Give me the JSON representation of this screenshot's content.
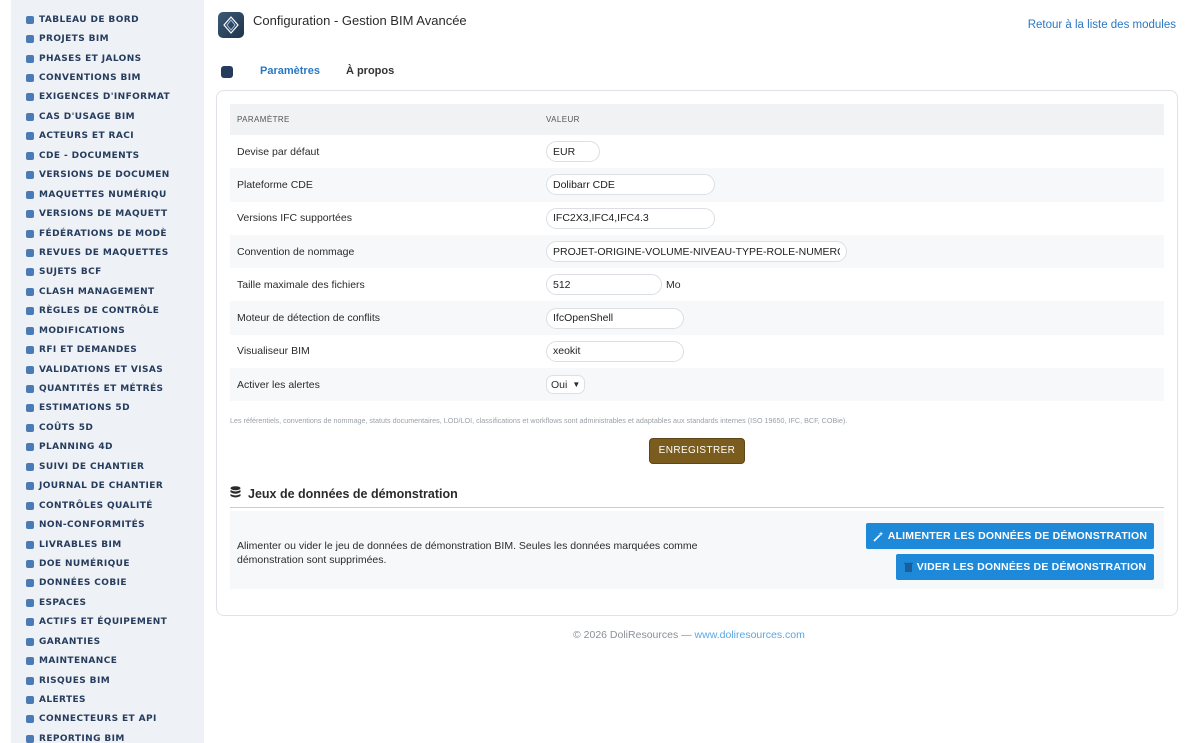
{
  "sidebar": {
    "items": [
      {
        "label": "TABLEAU DE BORD",
        "icon": "dashboard-icon"
      },
      {
        "label": "PROJETS BIM",
        "icon": "project-diagram-icon"
      },
      {
        "label": "PHASES ET JALONS",
        "icon": "layers-icon"
      },
      {
        "label": "CONVENTIONS BIM",
        "icon": "file-signature-icon"
      },
      {
        "label": "EXIGENCES D'INFORMAT",
        "icon": "clipboard-icon"
      },
      {
        "label": "CAS D'USAGE BIM",
        "icon": "clipboard-check-icon"
      },
      {
        "label": "ACTEURS ET RACI",
        "icon": "users-icon"
      },
      {
        "label": "CDE - DOCUMENTS",
        "icon": "folder-icon"
      },
      {
        "label": "VERSIONS DE DOCUMEN",
        "icon": "code-branch-icon"
      },
      {
        "label": "MAQUETTES NUMÉRIQU",
        "icon": "cubes-icon"
      },
      {
        "label": "VERSIONS DE MAQUETT",
        "icon": "code-branch-icon"
      },
      {
        "label": "FÉDÉRATIONS DE MODÈ",
        "icon": "sitemap-icon"
      },
      {
        "label": "REVUES DE MAQUETTES",
        "icon": "search-icon"
      },
      {
        "label": "SUJETS BCF",
        "icon": "comments-icon"
      },
      {
        "label": "CLASH MANAGEMENT",
        "icon": "warning-icon"
      },
      {
        "label": "RÈGLES DE CONTRÔLE",
        "icon": "cogs-icon"
      },
      {
        "label": "MODIFICATIONS",
        "icon": "edit-icon"
      },
      {
        "label": "RFI ET DEMANDES",
        "icon": "question-circle-icon"
      },
      {
        "label": "VALIDATIONS ET VISAS",
        "icon": "check-double-icon"
      },
      {
        "label": "QUANTITÉS ET MÉTRÉS",
        "icon": "calculator-icon"
      },
      {
        "label": "ESTIMATIONS 5D",
        "icon": "file-invoice-icon"
      },
      {
        "label": "COÛTS 5D",
        "icon": "money-bill-icon"
      },
      {
        "label": "PLANNING 4D",
        "icon": "calendar-icon"
      },
      {
        "label": "SUIVI DE CHANTIER",
        "icon": "hard-hat-icon"
      },
      {
        "label": "JOURNAL DE CHANTIER",
        "icon": "clipboard-list-icon"
      },
      {
        "label": "CONTRÔLES QUALITÉ",
        "icon": "check-circle-icon"
      },
      {
        "label": "NON-CONFORMITÉS",
        "icon": "times-circle-icon"
      },
      {
        "label": "LIVRABLES BIM",
        "icon": "briefcase-icon"
      },
      {
        "label": "DOE NUMÉRIQUE",
        "icon": "book-open-icon"
      },
      {
        "label": "DONNÉES COBIE",
        "icon": "table-icon"
      },
      {
        "label": "ESPACES",
        "icon": "door-open-icon"
      },
      {
        "label": "ACTIFS ET ÉQUIPEMENT",
        "icon": "cogs-icon"
      },
      {
        "label": "GARANTIES",
        "icon": "shield-icon"
      },
      {
        "label": "MAINTENANCE",
        "icon": "wrench-icon"
      },
      {
        "label": "RISQUES BIM",
        "icon": "warning-icon"
      },
      {
        "label": "ALERTES",
        "icon": "bell-icon"
      },
      {
        "label": "CONNECTEURS ET API",
        "icon": "plug-icon"
      },
      {
        "label": "REPORTING BIM",
        "icon": "chart-pie-icon"
      }
    ]
  },
  "header": {
    "title": "Configuration - Gestion BIM Avancée",
    "back_link": "Retour à la liste des modules"
  },
  "tabs": [
    {
      "label": "Paramètres",
      "active": true
    },
    {
      "label": "À propos",
      "active": false
    }
  ],
  "params": {
    "col_param": "PARAMÈTRE",
    "col_value": "VALEUR",
    "rows": [
      {
        "label": "Devise par défaut",
        "value": "EUR"
      },
      {
        "label": "Plateforme CDE",
        "value": "Dolibarr CDE"
      },
      {
        "label": "Versions IFC supportées",
        "value": "IFC2X3,IFC4,IFC4.3"
      },
      {
        "label": "Convention de nommage",
        "value": "PROJET-ORIGINE-VOLUME-NIVEAU-TYPE-ROLE-NUMERO"
      },
      {
        "label": "Taille maximale des fichiers",
        "value": "512",
        "unit": "Mo"
      },
      {
        "label": "Moteur de détection de conflits",
        "value": "IfcOpenShell"
      },
      {
        "label": "Visualiseur BIM",
        "value": "xeokit"
      },
      {
        "label": "Activer les alertes",
        "value": "Oui"
      }
    ],
    "hint": "Les référentiels, conventions de nommage, statuts documentaires, LOD/LOI, classifications et workflows sont administrables et adaptables aux standards internes (ISO 19650, IFC, BCF, COBie).",
    "save_label": "ENREGISTRER"
  },
  "demo": {
    "title": "Jeux de données de démonstration",
    "text": "Alimenter ou vider le jeu de données de démonstration BIM. Seules les données marquées comme démonstration sont supprimées.",
    "fill_label": "ALIMENTER LES DONNÉES DE DÉMONSTRATION",
    "empty_label": "VIDER LES DONNÉES DE DÉMONSTRATION"
  },
  "footer": {
    "text": "© 2026 DoliResources — ",
    "link": "www.doliresources.com"
  },
  "colors": {
    "accent": "#2a78c3",
    "sidebar_text": "#263c5c",
    "save_button": "#7a5c1f",
    "action_button": "#1e88d9"
  }
}
